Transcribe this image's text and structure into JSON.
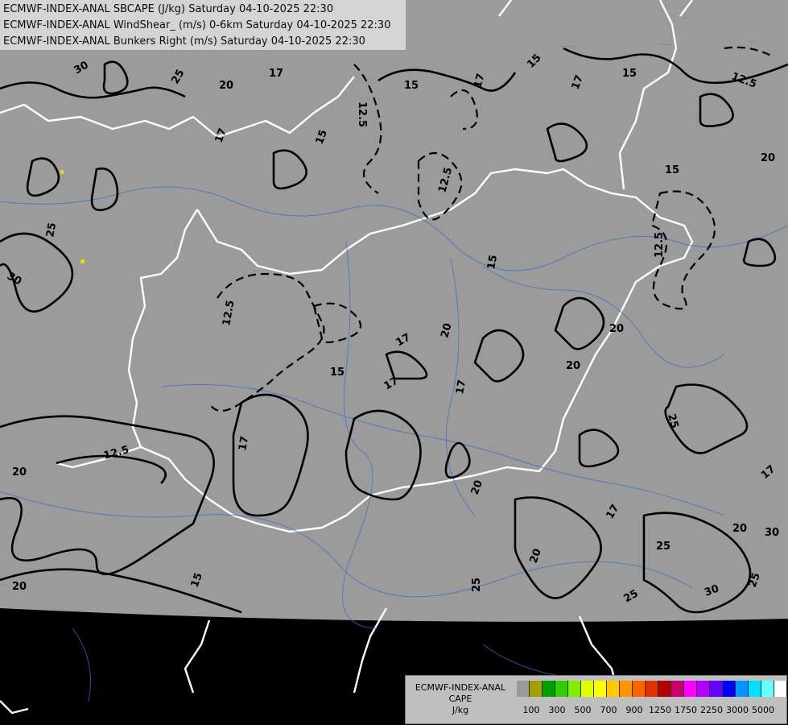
{
  "titles": {
    "line1": "ECMWF-INDEX-ANAL SBCAPE (J/kg) Saturday 04-10-2025 22:30",
    "line2": "ECMWF-INDEX-ANAL WindShear_ (m/s) 0-6km Saturday 04-10-2025 22:30",
    "line3": "ECMWF-INDEX-ANAL Bunkers Right (m/s) Saturday 04-10-2025 22:30"
  },
  "legend": {
    "source": "ECMWF-INDEX-ANAL",
    "variable": "CAPE",
    "unit": "J/kg",
    "swatch_colors": [
      "#9a9a9a",
      "#a0a000",
      "#00a000",
      "#2ed000",
      "#7cf000",
      "#e0ff00",
      "#ffff00",
      "#ffc800",
      "#ff9600",
      "#ff6400",
      "#e03200",
      "#b40000",
      "#c8006e",
      "#ff00ff",
      "#b400ff",
      "#6400ff",
      "#0000ff",
      "#0096ff",
      "#00e0ff",
      "#64ffff",
      "#ffffff"
    ],
    "tick_labels": [
      "100",
      "300",
      "500",
      "700",
      "900",
      "1250",
      "1750",
      "2250",
      "3000",
      "5000"
    ]
  },
  "map": {
    "contour_labels": [
      "30",
      "25",
      "20",
      "17",
      "15",
      "12.5"
    ],
    "colors": {
      "field": "#9b9b9b",
      "outside": "#000000",
      "contour": "#000000",
      "borders": "#ffffff",
      "rivers": "#3a6ec8"
    }
  }
}
